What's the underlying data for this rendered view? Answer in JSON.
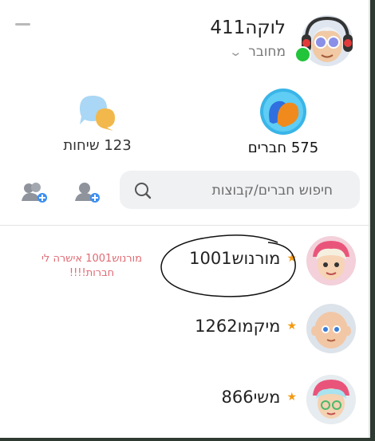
{
  "profile": {
    "name": "לוקה411",
    "status": "מחובר",
    "status_color": "#22c43a"
  },
  "stats": {
    "friends_label": "575 חברים",
    "chats_label": "123 שיחות"
  },
  "search": {
    "placeholder": "חיפוש חברים/קבוצות"
  },
  "icons": {
    "add_friend": "add-friend-icon",
    "add_group": "add-group-icon",
    "search": "search-icon"
  },
  "friends": [
    {
      "name": "מורנוש1001",
      "note": "מורנוש1001 אישרה לי חברות!!!!"
    },
    {
      "name": "מיקמו1262",
      "note": ""
    },
    {
      "name": "משי866",
      "note": ""
    }
  ],
  "colors": {
    "accent": "#3d8ff0",
    "star": "#f29a12",
    "note": "#e06a73"
  }
}
